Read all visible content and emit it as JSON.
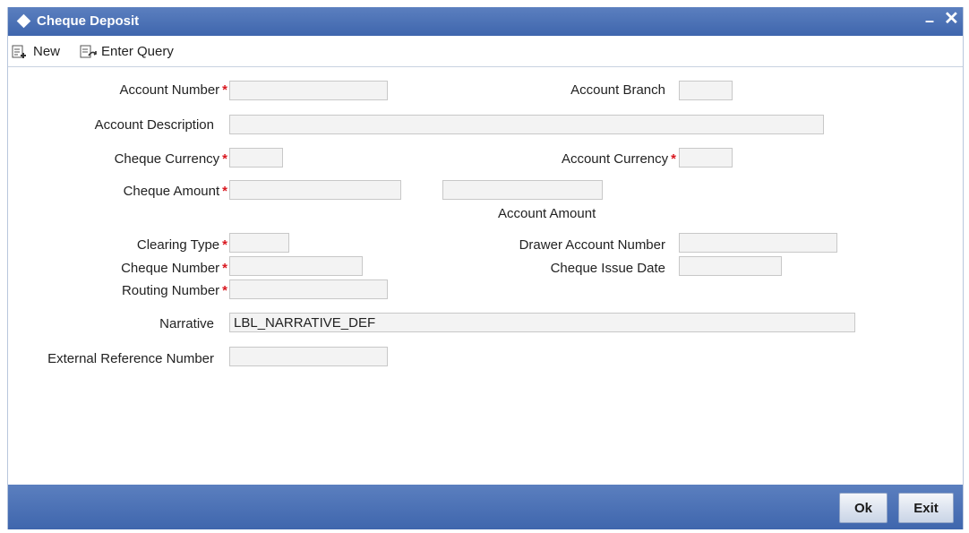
{
  "window": {
    "title": "Cheque Deposit"
  },
  "toolbar": {
    "new_label": "New",
    "enter_query_label": "Enter Query"
  },
  "form": {
    "account_number_label": "Account Number",
    "account_branch_label": "Account Branch",
    "account_description_label": "Account Description",
    "cheque_currency_label": "Cheque Currency",
    "account_currency_label": "Account Currency",
    "cheque_amount_label": "Cheque Amount",
    "account_amount_label": "Account Amount",
    "clearing_type_label": "Clearing Type",
    "drawer_account_number_label": "Drawer Account Number",
    "cheque_number_label": "Cheque Number",
    "cheque_issue_date_label": "Cheque Issue Date",
    "routing_number_label": "Routing Number",
    "narrative_label": "Narrative",
    "narrative_value": "LBL_NARRATIVE_DEF",
    "external_reference_number_label": "External Reference Number",
    "required_marker": "*"
  },
  "footer": {
    "ok_label": "Ok",
    "exit_label": "Exit"
  },
  "colors": {
    "titlebar": "#4a70b5",
    "required": "#d9171f",
    "field_bg": "#f3f3f3"
  }
}
